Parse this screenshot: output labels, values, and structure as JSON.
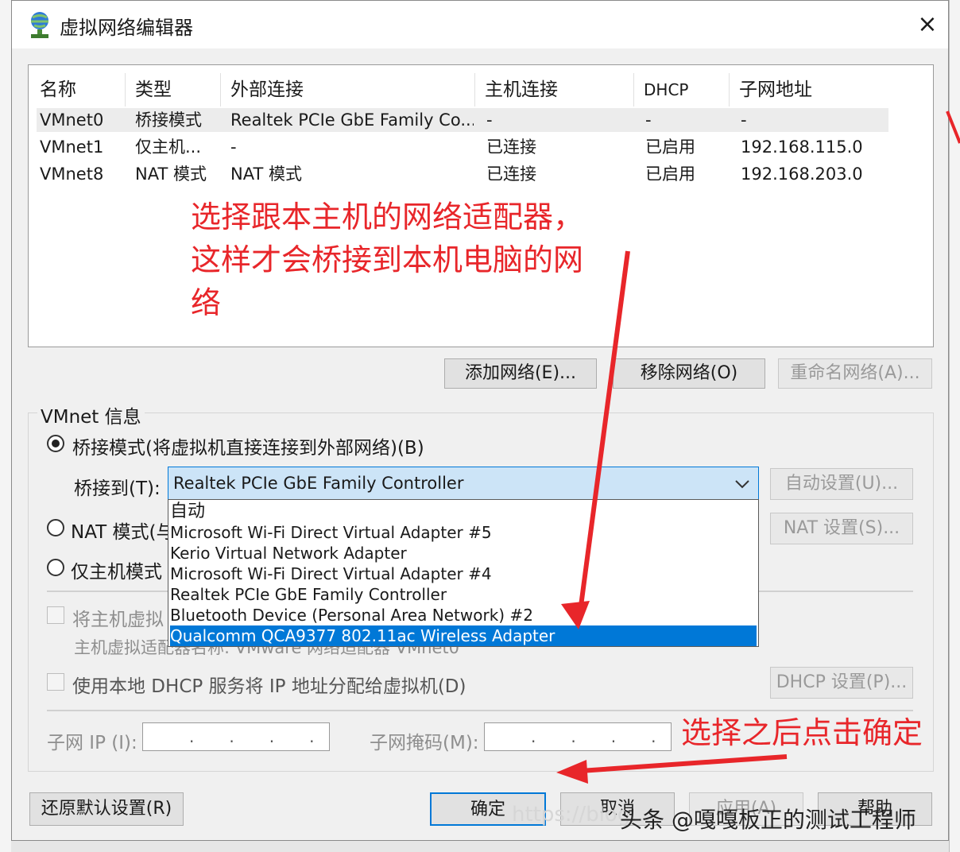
{
  "window": {
    "title": "虚拟网络编辑器",
    "close_icon": "×"
  },
  "columns": [
    "名称",
    "类型",
    "外部连接",
    "主机连接",
    "DHCP",
    "子网地址"
  ],
  "rows": [
    [
      "VMnet0",
      "桥接模式",
      "Realtek PCIe GbE Family Co...",
      "-",
      "-",
      "-"
    ],
    [
      "VMnet1",
      "仅主机...",
      "-",
      "已连接",
      "已启用",
      "192.168.115.0"
    ],
    [
      "VMnet8",
      "NAT 模式",
      "NAT 模式",
      "已连接",
      "已启用",
      "192.168.203.0"
    ]
  ],
  "list_buttons": {
    "add": "添加网络(E)...",
    "remove": "移除网络(O)",
    "rename": "重命名网络(A)..."
  },
  "vmnet_info": {
    "legend": "VMnet 信息",
    "bridged_label": "桥接模式(将虚拟机直接连接到外部网络)(B)",
    "bridge_to_label": "桥接到(T):",
    "bridge_to_value": "Realtek PCIe GbE Family Controller",
    "auto_settings": "自动设置(U)...",
    "nat_label": "NAT 模式(与",
    "nat_settings": "NAT 设置(S)...",
    "hostonly_label": "仅主机模式",
    "connect_host_label": "将主机虚拟",
    "host_adapter_label": "主机虚拟适配器名称: VMware 网络适配器 VMnet0",
    "dhcp_label": "使用本地 DHCP 服务将 IP 地址分配给虚拟机(D)",
    "dhcp_settings": "DHCP 设置(P)...",
    "subnet_ip_label": "子网 IP (I):",
    "subnet_mask_label": "子网掩码(M):",
    "ip_placeholder": "...."
  },
  "dropdown_options": [
    "自动",
    "Microsoft Wi-Fi Direct Virtual Adapter #5",
    "Kerio Virtual Network Adapter",
    "Microsoft Wi-Fi Direct Virtual Adapter #4",
    "Realtek PCIe GbE Family Controller",
    "Bluetooth Device (Personal Area Network) #2",
    "Qualcomm QCA9377 802.11ac Wireless Adapter"
  ],
  "dropdown_selected_index": 6,
  "footer_buttons": {
    "restore": "还原默认设置(R)",
    "ok": "确定",
    "cancel": "取消",
    "apply": "应用(A)",
    "help": "帮助"
  },
  "annotations": {
    "note1_line1": "选择跟本主机的网络适配器，",
    "note1_line2": "这样才会桥接到本机电脑的网",
    "note1_line3": "络",
    "note2": "选择之后点击确定",
    "arrow_color": "#e8262a"
  },
  "watermark": "头条 @嘎嘎板正的测试工程师",
  "watermark_faint": "https://blog..."
}
